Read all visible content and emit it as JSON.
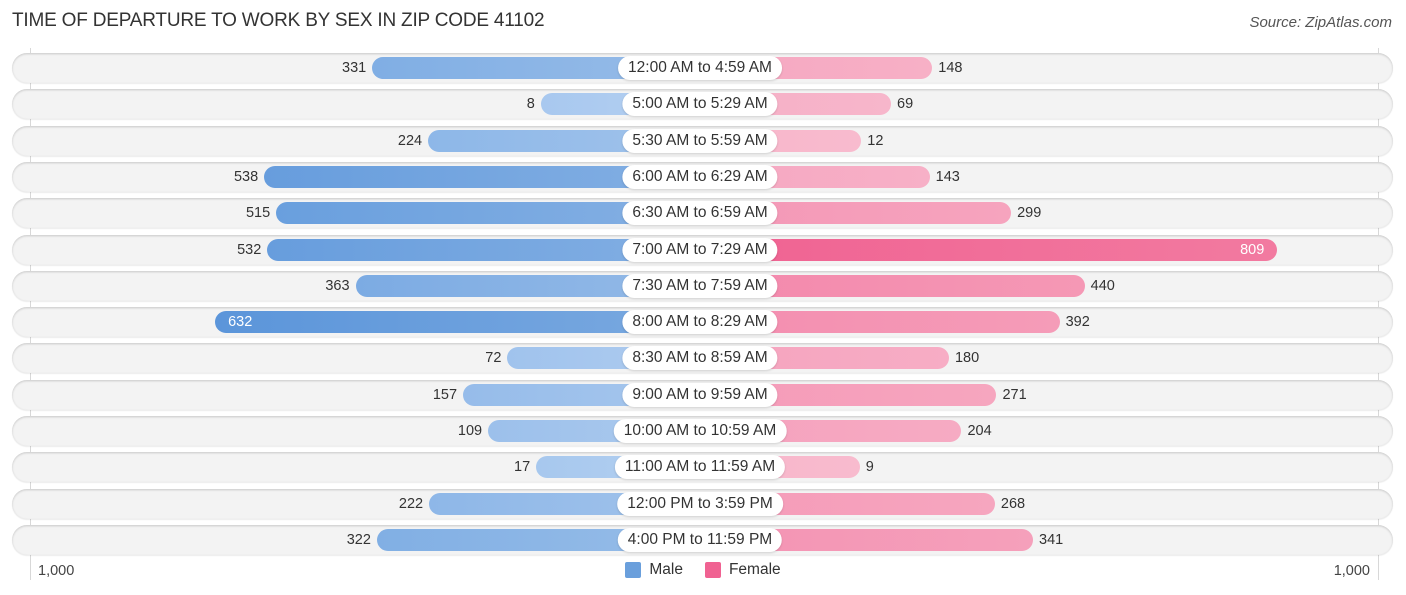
{
  "title": "TIME OF DEPARTURE TO WORK BY SEX IN ZIP CODE 41102",
  "source": "Source: ZipAtlas.com",
  "colors": {
    "male": "#6a9fdc",
    "male_light": "#a8c8ee",
    "female": "#f06292",
    "female_light": "#f4a3bd"
  },
  "chart_data": {
    "type": "bar",
    "orientation": "horizontal-diverging",
    "title": "TIME OF DEPARTURE TO WORK BY SEX IN ZIP CODE 41102",
    "categories": [
      "12:00 AM to 4:59 AM",
      "5:00 AM to 5:29 AM",
      "5:30 AM to 5:59 AM",
      "6:00 AM to 6:29 AM",
      "6:30 AM to 6:59 AM",
      "7:00 AM to 7:29 AM",
      "7:30 AM to 7:59 AM",
      "8:00 AM to 8:29 AM",
      "8:30 AM to 8:59 AM",
      "9:00 AM to 9:59 AM",
      "10:00 AM to 10:59 AM",
      "11:00 AM to 11:59 AM",
      "12:00 PM to 3:59 PM",
      "4:00 PM to 11:59 PM"
    ],
    "series": [
      {
        "name": "Male",
        "side": "left",
        "values": [
          331,
          8,
          224,
          538,
          515,
          532,
          363,
          632,
          72,
          157,
          109,
          17,
          222,
          322
        ]
      },
      {
        "name": "Female",
        "side": "right",
        "values": [
          148,
          69,
          12,
          143,
          299,
          809,
          440,
          392,
          180,
          271,
          204,
          9,
          268,
          341
        ]
      }
    ],
    "xlim": [
      0,
      1000
    ],
    "tick_labels": {
      "left": "1,000",
      "right": "1,000"
    },
    "legend": [
      "Male",
      "Female"
    ],
    "legend_position": "bottom-center",
    "grid": false
  }
}
